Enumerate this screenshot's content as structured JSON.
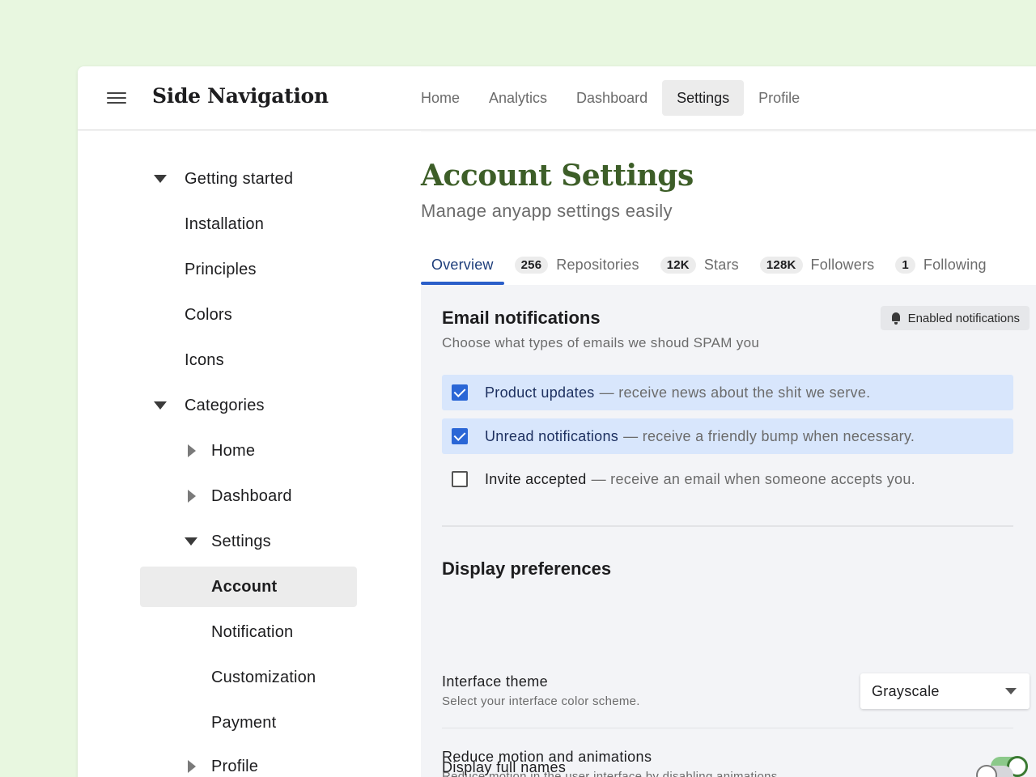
{
  "app": {
    "title": "Side Navigation"
  },
  "topnav": {
    "items": [
      {
        "label": "Home"
      },
      {
        "label": "Analytics"
      },
      {
        "label": "Dashboard"
      },
      {
        "label": "Settings",
        "active": true
      },
      {
        "label": "Profile"
      }
    ]
  },
  "sidenav": {
    "getting_started": "Getting started",
    "installation": "Installation",
    "principles": "Principles",
    "colors": "Colors",
    "icons": "Icons",
    "categories": "Categories",
    "home": "Home",
    "dashboard": "Dashboard",
    "settings": "Settings",
    "account": "Account",
    "notification": "Notification",
    "customization": "Customization",
    "payment": "Payment",
    "profile": "Profile"
  },
  "main": {
    "title": "Account Settings",
    "subtitle": "Manage anyapp settings easily",
    "tabs": {
      "overview": "Overview",
      "repositories": {
        "count": "256",
        "label": "Repositories"
      },
      "stars": {
        "count": "12K",
        "label": "Stars"
      },
      "followers": {
        "count": "128K",
        "label": "Followers"
      },
      "following": {
        "count": "1",
        "label": "Following"
      }
    }
  },
  "email": {
    "title": "Email notifications",
    "description": "Choose what types of emails we shoud SPAM you",
    "badge": "Enabled notifications",
    "options": [
      {
        "label": "Product updates",
        "rest": "— receive news about the shit we serve.",
        "checked": true
      },
      {
        "label": "Unread notifications",
        "rest": "— receive a friendly bump when necessary.",
        "checked": true
      },
      {
        "label": "Invite accepted",
        "rest": "— receive an email when someone accepts you.",
        "checked": false
      }
    ]
  },
  "display": {
    "title": "Display preferences",
    "theme": {
      "label": "Interface theme",
      "help": "Select your interface color scheme.",
      "value": "Grayscale"
    },
    "motion": {
      "label": "Reduce motion and animations",
      "help": "Reduce motion in the user interface by disabling animations.",
      "enabled": true
    },
    "fullnames": {
      "label": "Display full names",
      "enabled": false
    }
  },
  "colors": {
    "background": "#e8f7e0",
    "title_green": "#3d5e28",
    "accent_blue": "#2a5ec9",
    "checked_row": "#d8e6fc",
    "toggle_on": "#8bc98a"
  }
}
